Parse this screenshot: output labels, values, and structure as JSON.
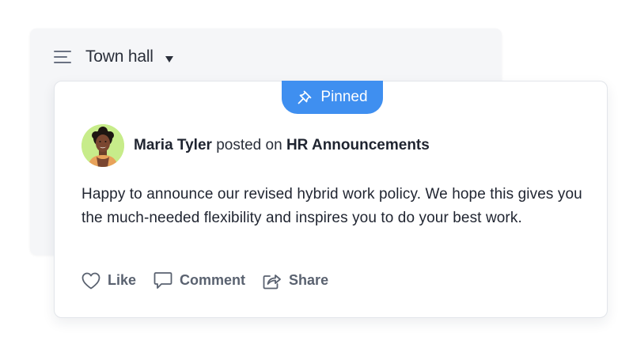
{
  "channel": {
    "title": "Town hall"
  },
  "post": {
    "pinned_label": "Pinned",
    "author": "Maria Tyler",
    "posted_on_text": "posted on",
    "channel_name": "HR Announcements",
    "body": "Happy to announce our revised hybrid work policy. We hope this gives you the much-needed flexibility and inspires you to do your best work.",
    "actions": {
      "like_label": "Like",
      "comment_label": "Comment",
      "share_label": "Share"
    }
  },
  "colors": {
    "accent": "#3f8ff0",
    "avatar_bg": "#c7ec8a",
    "text_primary": "#1f2430",
    "text_muted": "#5a6270"
  },
  "icons": {
    "menu": "menu-lines-icon",
    "dropdown": "caret-down-icon",
    "pin": "pin-icon",
    "like": "heart-icon",
    "comment": "comment-bubble-icon",
    "share": "share-arrow-icon"
  }
}
